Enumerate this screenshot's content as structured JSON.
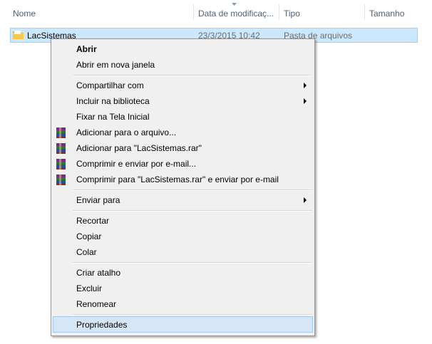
{
  "columns": {
    "name": "Nome",
    "date": "Data de modificaç...",
    "type": "Tipo",
    "size": "Tamanho"
  },
  "row": {
    "name": "LacSistemas",
    "date": "23/3/2015 10:42",
    "type": "Pasta de arquivos",
    "icon": "folder-icon"
  },
  "menu": {
    "open": "Abrir",
    "open_new_window": "Abrir em nova janela",
    "share_with": "Compartilhar com",
    "include_library": "Incluir na biblioteca",
    "pin_start": "Fixar na Tela Inicial",
    "add_archive": "Adicionar para o arquivo...",
    "add_rar": "Adicionar para \"LacSistemas.rar\"",
    "compress_email": "Comprimir e enviar por e-mail...",
    "compress_rar_email": "Comprimir para \"LacSistemas.rar\" e enviar por e-mail",
    "send_to": "Enviar para",
    "cut": "Recortar",
    "copy": "Copiar",
    "paste": "Colar",
    "create_shortcut": "Criar atalho",
    "delete": "Excluir",
    "rename": "Renomear",
    "properties": "Propriedades"
  },
  "colors": {
    "selection": "#cce8ff",
    "menu_bg": "#f0f0f0",
    "hover": "#d5e6f7",
    "header_text": "#4c607a"
  }
}
